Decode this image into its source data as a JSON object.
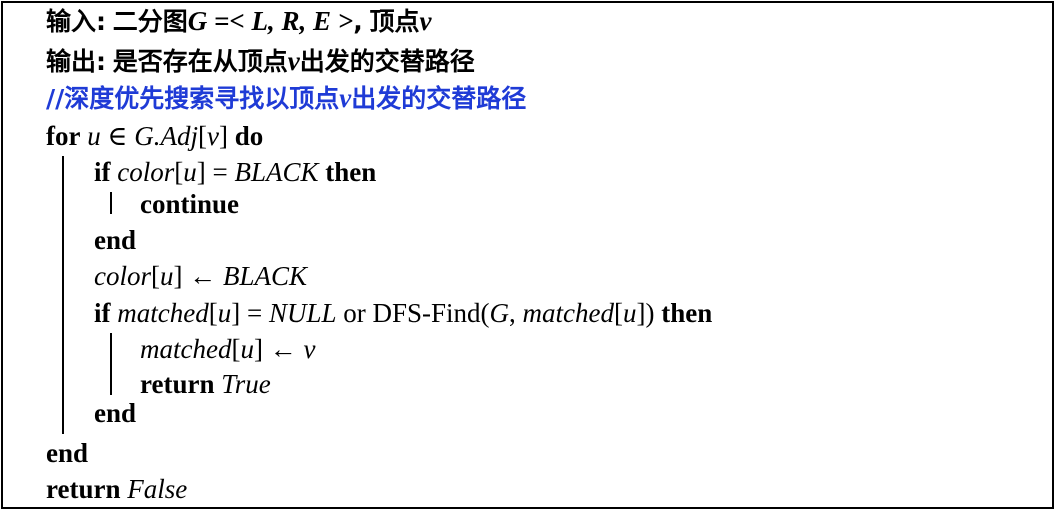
{
  "header": {
    "input_label": "输入:",
    "input_text": "二分图",
    "input_formula": "G =< L, R, E >",
    "input_sep": ",",
    "input_tail": "顶点",
    "input_var": "v",
    "output_label": "输出:",
    "output_text_a": "是否存在从顶点",
    "output_var": "v",
    "output_text_b": "出发的交替路径",
    "comment_a": "//深度优先搜索寻找以顶点",
    "comment_var": "v",
    "comment_b": "出发的交替路径"
  },
  "algorithm": {
    "for_kw": "for",
    "for_var": "u",
    "in_sym": "∈",
    "for_expr": "G.Adj",
    "lbr": "[",
    "for_idx": "v",
    "rbr": "]",
    "do_kw": "do",
    "if1_kw": "if",
    "if1_fn": "color",
    "if1_idx": "u",
    "eq": "=",
    "black": "BLACK",
    "then_kw": "then",
    "continue_kw": "continue",
    "end_kw": "end",
    "assign_fn": "color",
    "assign_idx": "u",
    "arrow": "←",
    "assign_val": "BLACK",
    "if2_kw": "if",
    "matched_fn": "matched",
    "matched_idx": "u",
    "null_val": "NULL",
    "or_kw": "or",
    "dfs_name": "DFS-Find(",
    "dfs_g": "G",
    "comma": ",",
    "dfs_arg": "matched",
    "dfs_idx": "u",
    "dfs_close": "])",
    "then2_kw": "then",
    "m_assign_fn": "matched",
    "m_assign_idx": "u",
    "m_assign_val": "v",
    "return_kw": "return",
    "true_val": "True",
    "end2_kw": "end",
    "end3_kw": "end",
    "final_return_kw": "return",
    "false_val": "False"
  },
  "colors": {
    "comment": "#1f3bd6",
    "text": "#000000",
    "border": "#000000"
  }
}
